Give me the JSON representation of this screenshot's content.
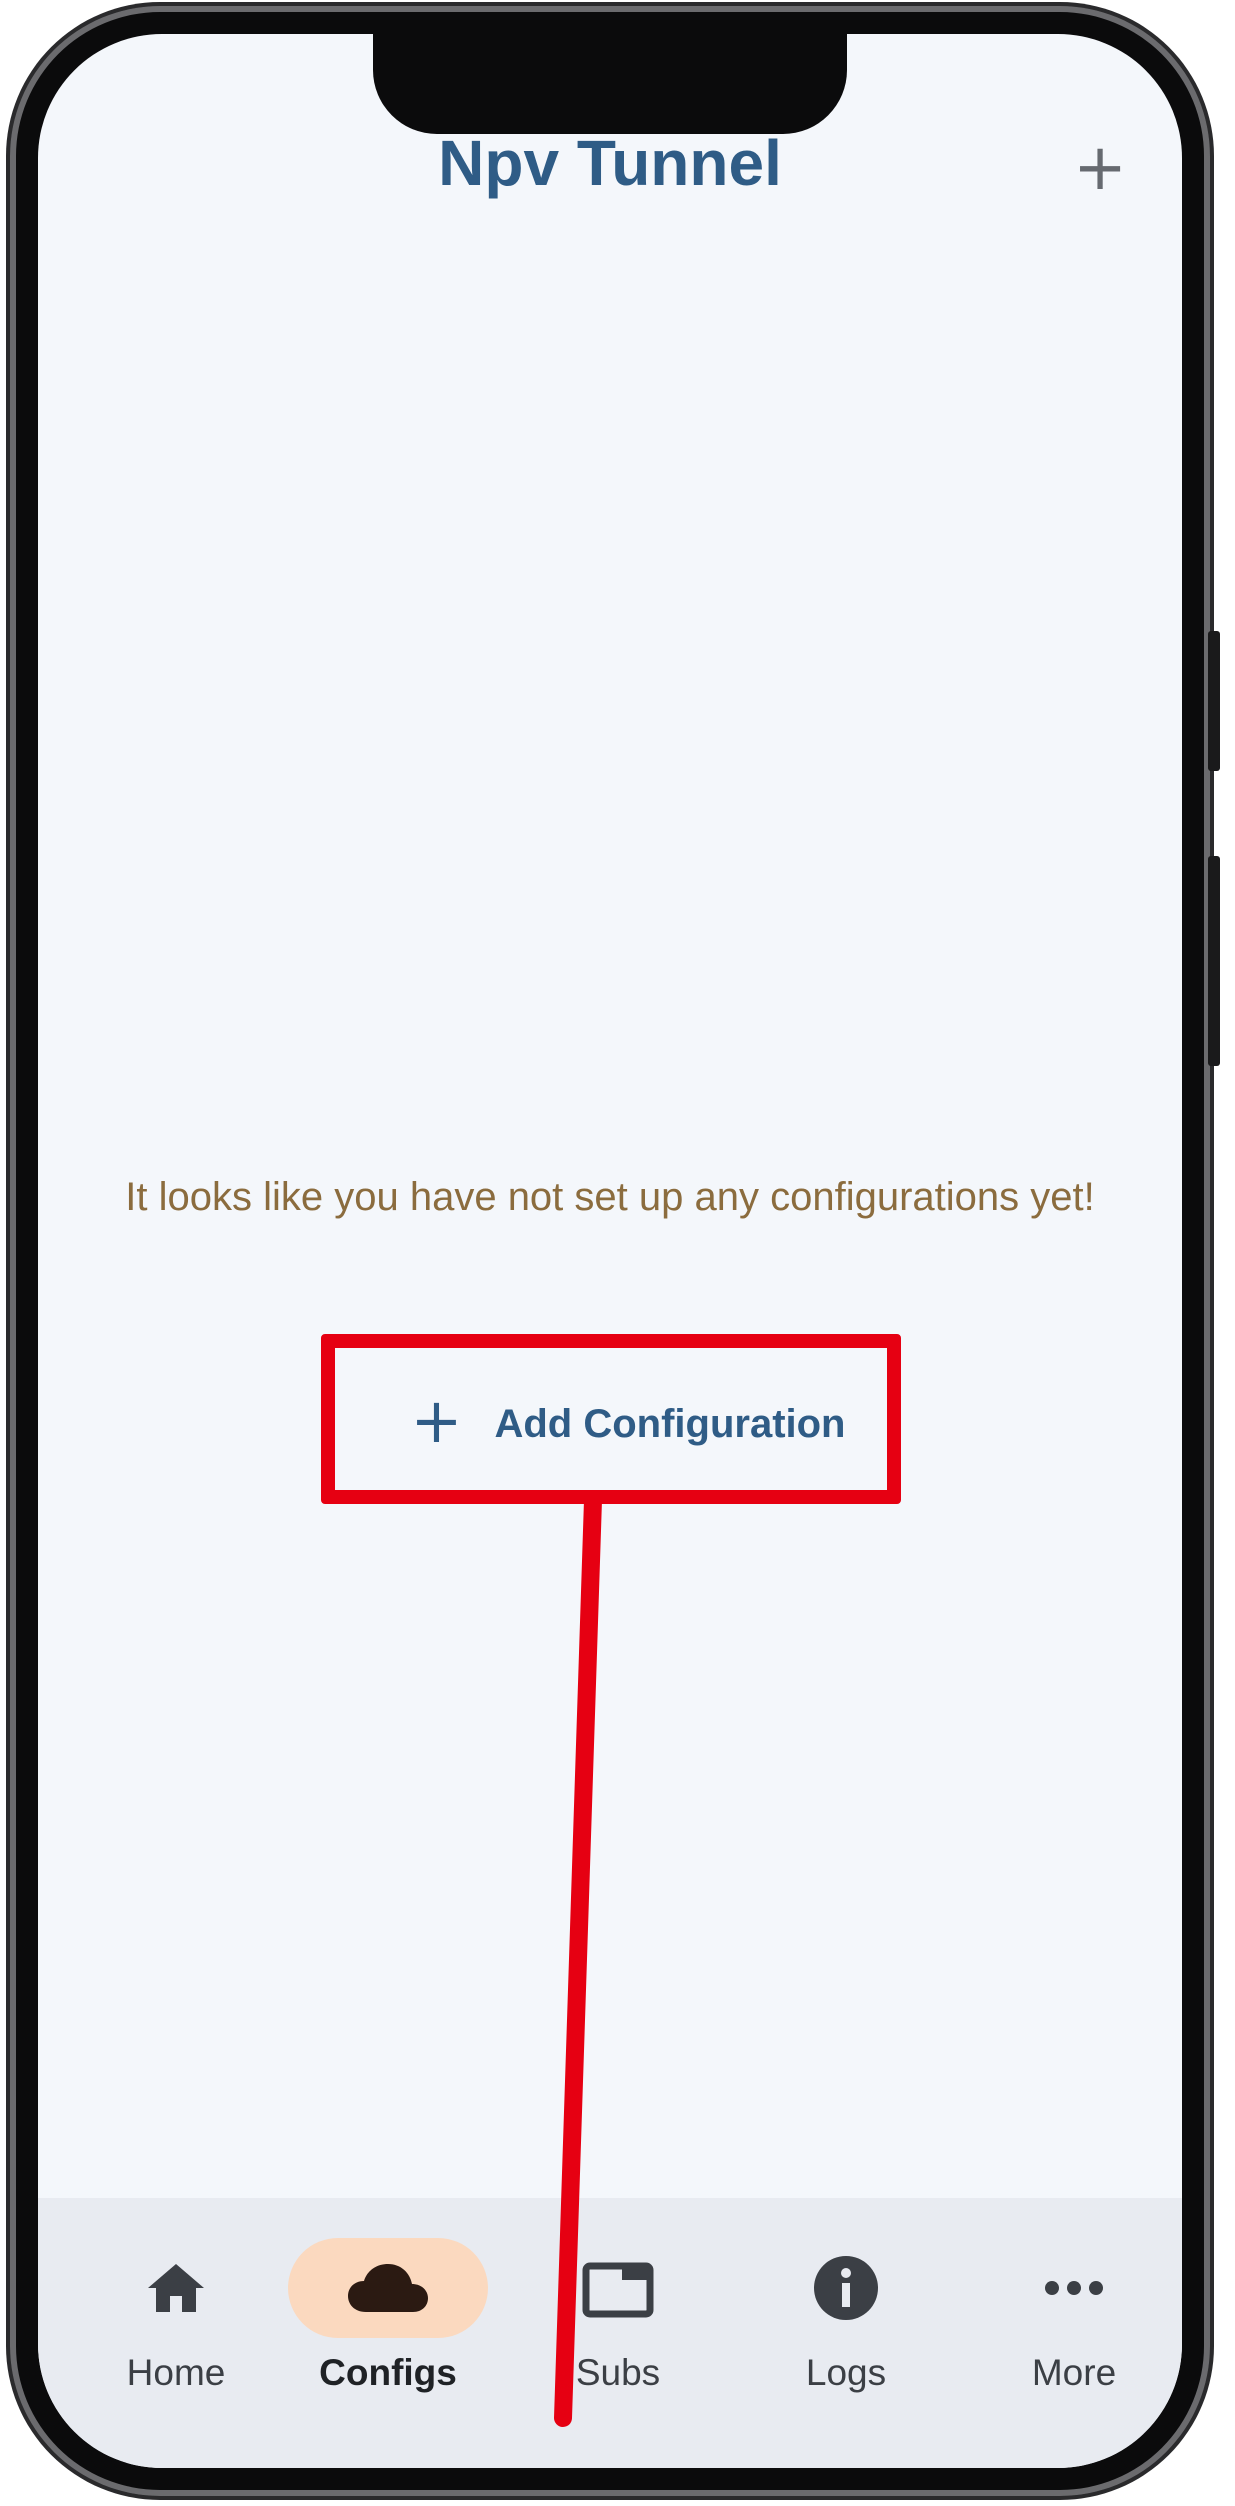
{
  "header": {
    "title": "Npv Tunnel",
    "add_icon": "plus-icon"
  },
  "empty_state": {
    "message": "It looks like you have not set up any configurations yet!",
    "add_button_label": "Add Configuration",
    "add_button_icon": "plus-icon"
  },
  "nav": {
    "active": "Configs",
    "items": [
      {
        "label": "Home",
        "icon": "home-icon"
      },
      {
        "label": "Configs",
        "icon": "cloud-icon"
      },
      {
        "label": "Subs",
        "icon": "subscriptions-icon"
      },
      {
        "label": "Logs",
        "icon": "info-icon"
      },
      {
        "label": "More",
        "icon": "more-horizontal-icon"
      }
    ]
  },
  "colors": {
    "title": "#2f5c86",
    "message": "#8b6c3e",
    "active_pill": "#fbd9bf",
    "highlight": "#e60012",
    "screen_bg": "#f4f7fb",
    "nav_bg": "#e8ebf1"
  }
}
